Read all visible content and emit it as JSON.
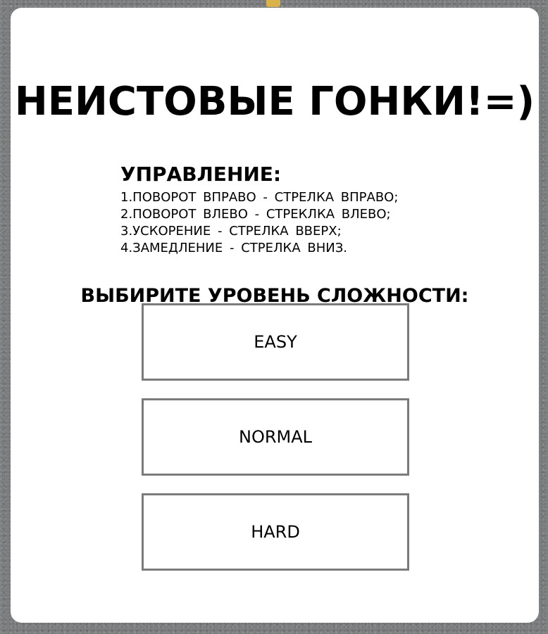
{
  "title": "НЕИСТОВЫЕ ГОНКИ!=)",
  "controls": {
    "heading": "УПРАВЛЕНИЕ:",
    "items": [
      "1.ПОВОРОТ ВПРАВО - СТРЕЛКА ВПРАВО;",
      "2.ПОВОРОТ ВЛЕВО - СТРЕКЛКА ВЛЕВО;",
      "3.УСКОРЕНИЕ - СТРЕЛКА ВВЕРХ;",
      "4.ЗАМЕДЛЕНИЕ - СТРЕЛКА ВНИЗ."
    ]
  },
  "difficulty": {
    "prompt": "ВЫБИРИТЕ УРОВЕНЬ СЛОЖНОСТИ:",
    "buttons": {
      "easy": "EASY",
      "normal": "NORMAL",
      "hard": "HARD"
    }
  },
  "colors": {
    "background": "#7d7f80",
    "panel": "#ffffff",
    "button_border": "#7b7b7b",
    "road_marking": "#d9b24a"
  }
}
